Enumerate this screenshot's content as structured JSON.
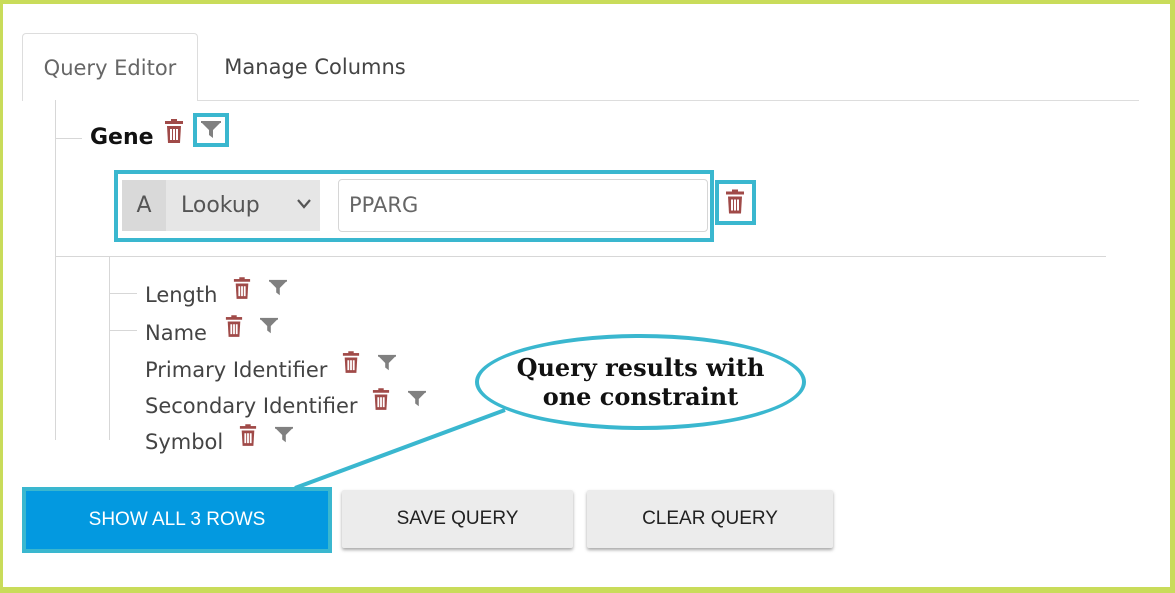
{
  "tabs": [
    {
      "label": "Query Editor",
      "active": true
    },
    {
      "label": "Manage Columns",
      "active": false
    }
  ],
  "tree": {
    "root_label": "Gene",
    "constraint": {
      "code": "A",
      "operator": "Lookup",
      "value": "PPARG"
    },
    "attributes": [
      {
        "label": "Length"
      },
      {
        "label": "Name"
      },
      {
        "label": "Primary Identifier"
      },
      {
        "label": "Secondary Identifier"
      },
      {
        "label": "Symbol"
      }
    ]
  },
  "callout": {
    "line1": "Query results with",
    "line2": "one constraint"
  },
  "buttons": {
    "show_rows": "SHOW ALL 3 ROWS",
    "save_query": "SAVE QUERY",
    "clear_query": "CLEAR QUERY"
  },
  "colors": {
    "frame": "#c9dc5a",
    "highlight": "#3ab7cf",
    "primary_button": "#0399e0",
    "trash_icon": "#a04a48",
    "filter_icon": "#808080"
  },
  "icons": {
    "delete": "trash-icon",
    "filter": "filter-icon"
  }
}
